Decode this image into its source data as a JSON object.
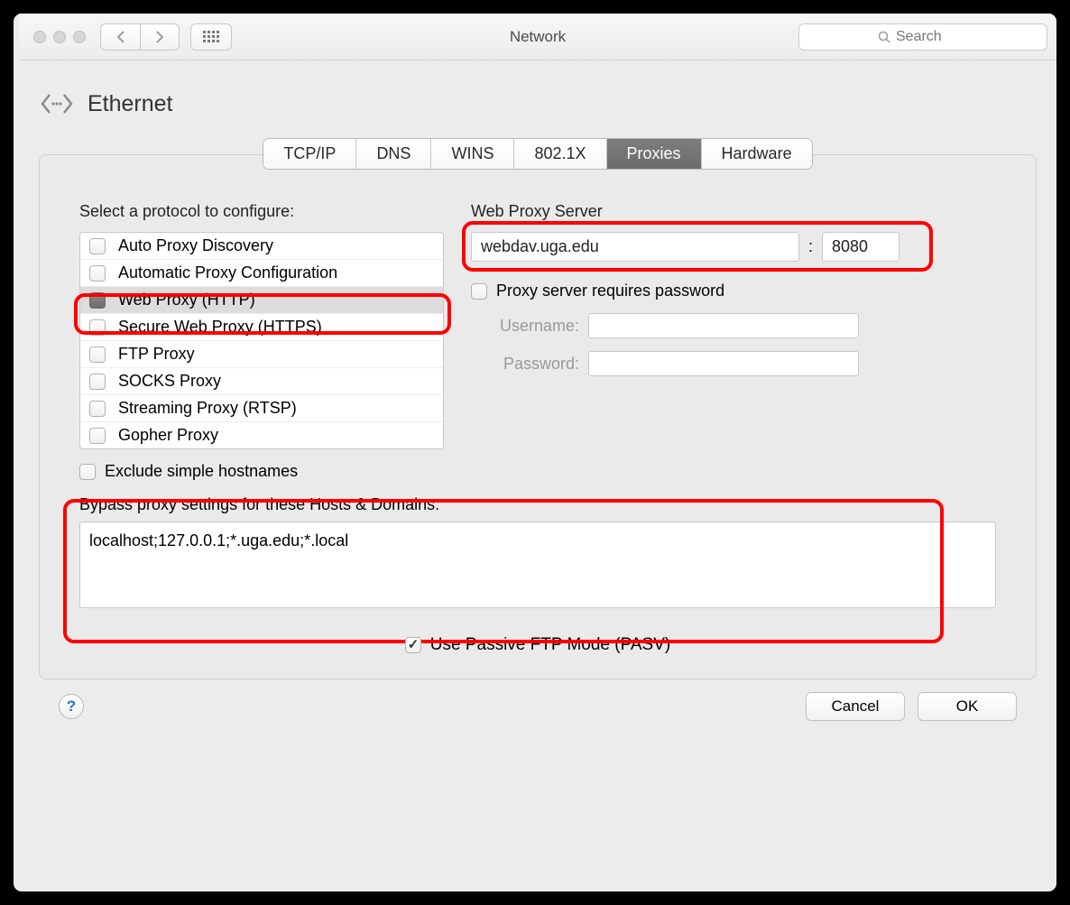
{
  "window": {
    "title": "Network",
    "search_placeholder": "Search"
  },
  "header": {
    "interface": "Ethernet"
  },
  "tabs": [
    "TCP/IP",
    "DNS",
    "WINS",
    "802.1X",
    "Proxies",
    "Hardware"
  ],
  "active_tab_index": 4,
  "left": {
    "select_label": "Select a protocol to configure:",
    "protocols": [
      {
        "label": "Auto Proxy Discovery",
        "checked": false,
        "selected": false
      },
      {
        "label": "Automatic Proxy Configuration",
        "checked": false,
        "selected": false
      },
      {
        "label": "Web Proxy (HTTP)",
        "checked": true,
        "selected": true
      },
      {
        "label": "Secure Web Proxy (HTTPS)",
        "checked": false,
        "selected": false
      },
      {
        "label": "FTP Proxy",
        "checked": false,
        "selected": false
      },
      {
        "label": "SOCKS Proxy",
        "checked": false,
        "selected": false
      },
      {
        "label": "Streaming Proxy (RTSP)",
        "checked": false,
        "selected": false
      },
      {
        "label": "Gopher Proxy",
        "checked": false,
        "selected": false
      }
    ],
    "exclude_simple": "Exclude simple hostnames"
  },
  "right": {
    "server_label": "Web Proxy Server",
    "host": "webdav.uga.edu",
    "port": "8080",
    "colon": ":",
    "requires_password": "Proxy server requires password",
    "username_label": "Username:",
    "password_label": "Password:"
  },
  "bypass": {
    "label": "Bypass proxy settings for these Hosts & Domains:",
    "value": "localhost;127.0.0.1;*.uga.edu;*.local"
  },
  "pasv": "Use Passive FTP Mode (PASV)",
  "footer": {
    "cancel": "Cancel",
    "ok": "OK"
  }
}
